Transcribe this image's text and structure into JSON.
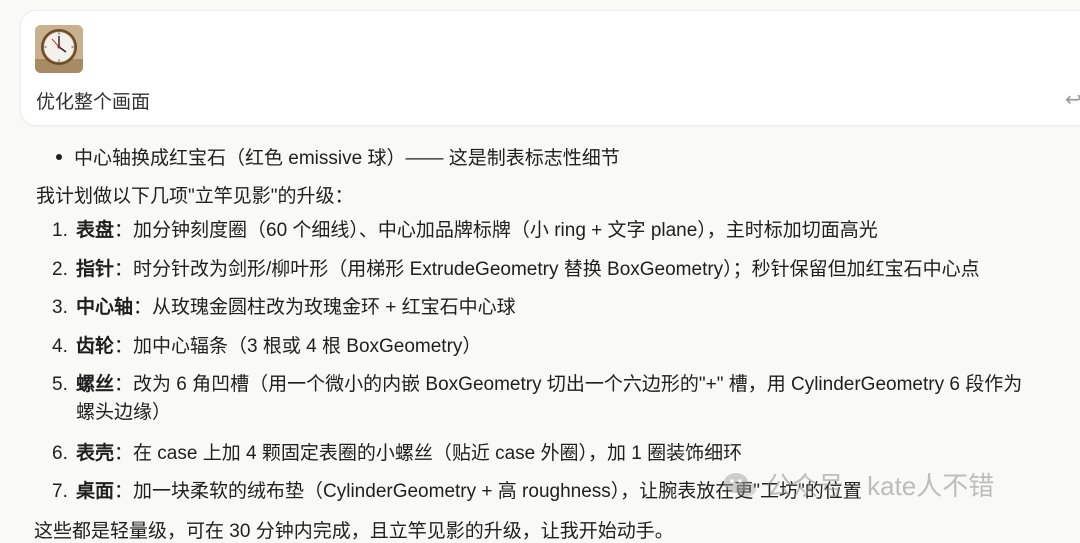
{
  "user_message": {
    "text": "优化整个画面",
    "reply_icon": "reply-arrow-icon"
  },
  "assistant": {
    "bullet": "中心轴换成红宝石（红色 emissive 球）—— 这是制表标志性细节",
    "intro": "我计划做以下几项\"立竿见影\"的升级：",
    "items": [
      {
        "num": "1.",
        "title": "表盘",
        "text": "：加分钟刻度圈（60 个细线）、中心加品牌标牌（小 ring + 文字 plane），主时标加切面高光"
      },
      {
        "num": "2.",
        "title": "指针",
        "text": "：时分针改为剑形/柳叶形（用梯形 ExtrudeGeometry 替换 BoxGeometry）；秒针保留但加红宝石中心点"
      },
      {
        "num": "3.",
        "title": "中心轴",
        "text": "：从玫瑰金圆柱改为玫瑰金环 + 红宝石中心球"
      },
      {
        "num": "4.",
        "title": "齿轮",
        "text": "：加中心辐条（3 根或 4 根 BoxGeometry）"
      },
      {
        "num": "5.",
        "title": "螺丝",
        "text": "：改为 6 角凹槽（用一个微小的内嵌 BoxGeometry 切出一个六边形的\"+\" 槽，用 CylinderGeometry 6 段作为",
        "cont": "螺头边缘）"
      },
      {
        "num": "6.",
        "title": "表壳",
        "text": "：在 case 上加 4 颗固定表圈的小螺丝（贴近 case 外圈），加 1 圈装饰细环"
      },
      {
        "num": "7.",
        "title": "桌面",
        "text": "：加一块柔软的绒布垫（CylinderGeometry + 高 roughness），让腕表放在更\"工坊\"的位置"
      }
    ],
    "bottom": "这些都是轻量级，可在 30 分钟内完成，且立竿见影的升级，让我开始动手。"
  },
  "watermark": {
    "text": "公众号 · kate人不错",
    "icon": "wechat-icon"
  }
}
